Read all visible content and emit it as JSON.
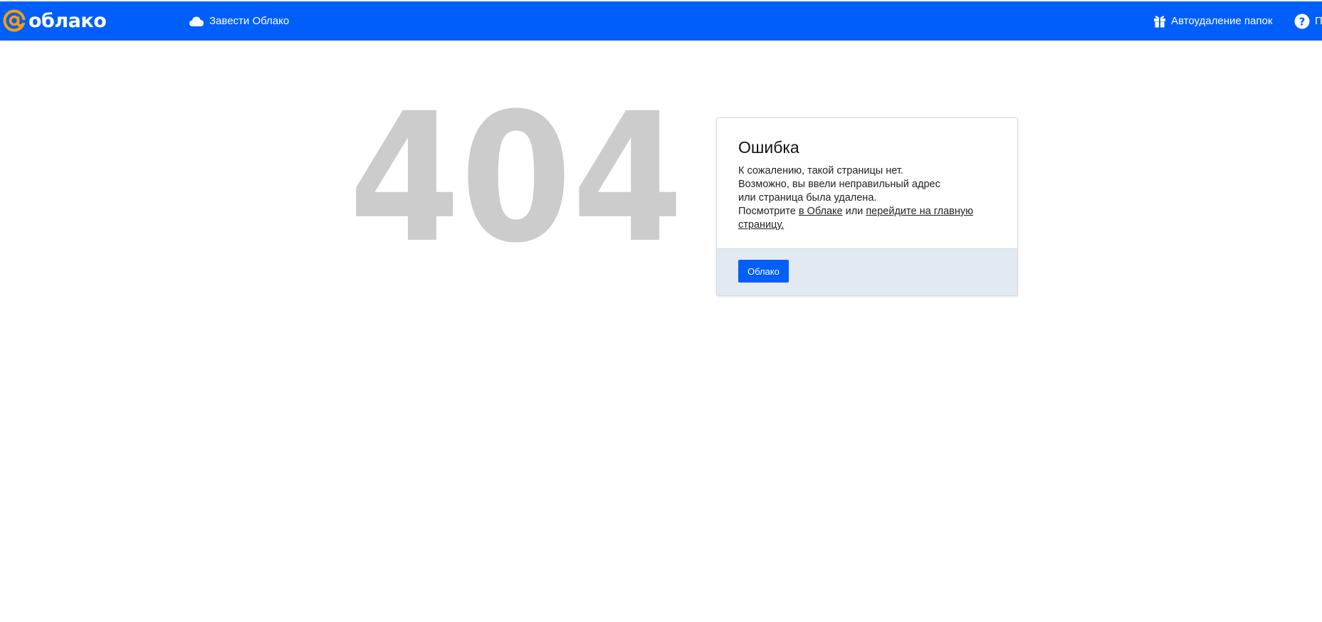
{
  "header": {
    "logo_text": "облако",
    "create_cloud_label": "Завести Облако",
    "autodelete_label": "Автоудаление папок",
    "help_label": "П"
  },
  "icons": {
    "logo": "at-sign-icon",
    "create_cloud": "cloud-icon",
    "autodelete": "gift-icon",
    "help": "question-circle-icon"
  },
  "colors": {
    "brand_blue": "#005ff9",
    "logo_orange": "#ff9e00",
    "big404_gray": "#cccccc",
    "card_footer_bg": "#e3e9f0"
  },
  "error": {
    "code": "404",
    "title": "Ошибка",
    "line1": "К сожалению, такой страницы нет.",
    "line2": "Возможно, вы ввели неправильный адрес",
    "line3": "или страница была удалена.",
    "line4_prefix": "Посмотрите ",
    "link_cloud": "в Облаке",
    "line4_middle": " или ",
    "link_home": "перейдите на главную страницу.",
    "button_label": "Облако"
  }
}
